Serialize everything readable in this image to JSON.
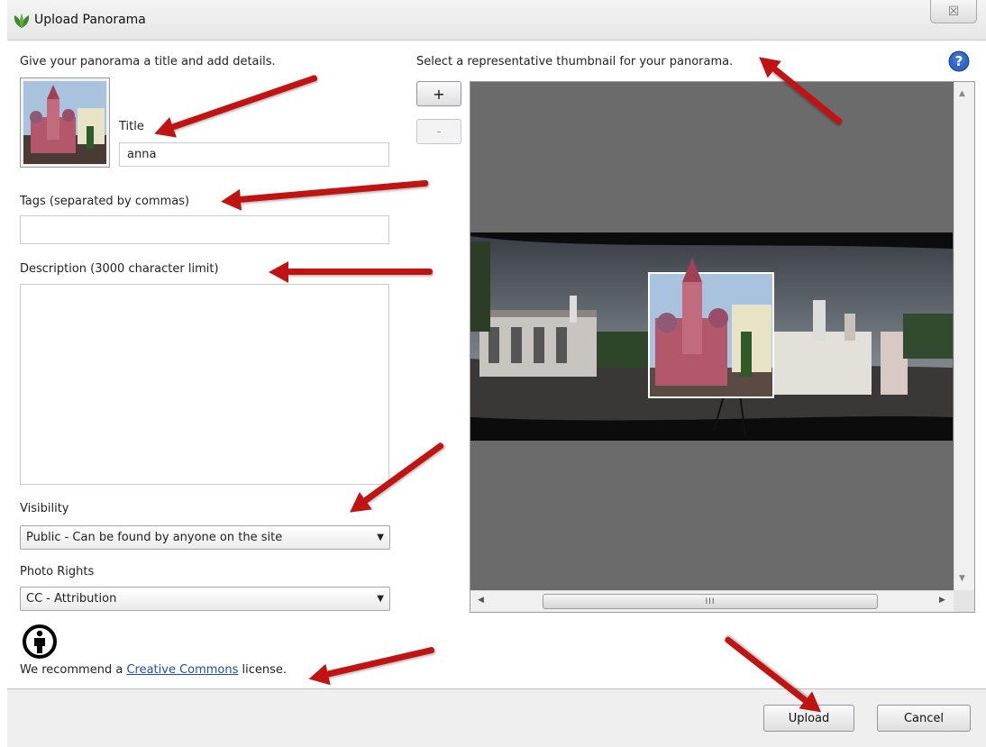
{
  "window": {
    "title": "Upload Panorama",
    "close_glyph": "☒"
  },
  "details": {
    "heading": "Give your panorama a title and add details.",
    "title_label": "Title",
    "title_value": "anna",
    "tags_label": "Tags (separated by commas)",
    "tags_value": "",
    "description_label": "Description (3000 character limit)",
    "description_value": "",
    "visibility_label": "Visibility",
    "visibility_value": "Public - Can be found by anyone on the site",
    "rights_label": "Photo Rights",
    "rights_value": "CC - Attribution",
    "license_prefix": "We recommend a ",
    "license_link": "Creative Commons",
    "license_suffix": " license."
  },
  "thumbnail": {
    "heading": "Select a representative thumbnail for your panorama.",
    "zoom_in": "+",
    "zoom_out": "-",
    "scroll_thumb_glyph": "III"
  },
  "footer": {
    "upload": "Upload",
    "cancel": "Cancel"
  },
  "icons": [
    "app-leaf-icon",
    "help-icon",
    "attribution-icon",
    "close-icon",
    "scroll-up-icon",
    "scroll-down-icon",
    "scroll-left-icon",
    "scroll-right-icon",
    "chevron-down-icon"
  ],
  "colors": {
    "arrow": "#c21313",
    "link": "#1a4fb5",
    "viewer_bg": "#6b6b6b"
  }
}
